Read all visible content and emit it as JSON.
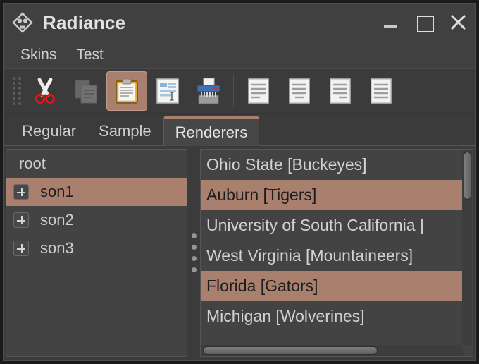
{
  "window": {
    "title": "Radiance",
    "app_icon": "diamond-logo-icon",
    "controls": {
      "minimize": "minimize-icon",
      "maximize": "maximize-icon",
      "close": "close-icon"
    }
  },
  "menubar": {
    "items": [
      {
        "label": "Skins"
      },
      {
        "label": "Test"
      }
    ]
  },
  "toolbar": {
    "grip": "drag-grip-icon",
    "buttons": [
      {
        "icon": "cut-scissors-icon",
        "label": "Cut",
        "state": "normal"
      },
      {
        "icon": "copy-icon",
        "label": "Copy",
        "state": "disabled"
      },
      {
        "icon": "paste-clipboard-icon",
        "label": "Paste",
        "state": "selected"
      },
      {
        "icon": "paste-special-icon",
        "label": "Paste Special",
        "state": "normal"
      },
      {
        "icon": "shredder-icon",
        "label": "Shred",
        "state": "normal"
      },
      {
        "icon": "align-left-icon",
        "label": "Align Left",
        "state": "normal"
      },
      {
        "icon": "align-center-icon",
        "label": "Align Center",
        "state": "normal"
      },
      {
        "icon": "align-right-icon",
        "label": "Align Right",
        "state": "normal"
      },
      {
        "icon": "align-justify-icon",
        "label": "Justify",
        "state": "normal"
      }
    ]
  },
  "tabs": {
    "items": [
      {
        "label": "Regular",
        "active": false
      },
      {
        "label": "Sample",
        "active": false
      },
      {
        "label": "Renderers",
        "active": true
      }
    ]
  },
  "tree": {
    "nodes": [
      {
        "label": "root",
        "expander": false,
        "selected": false
      },
      {
        "label": "son1",
        "expander": true,
        "selected": true
      },
      {
        "label": "son2",
        "expander": true,
        "selected": false
      },
      {
        "label": "son3",
        "expander": true,
        "selected": false
      }
    ]
  },
  "list": {
    "items": [
      {
        "label": "Ohio State [Buckeyes]",
        "selected": false
      },
      {
        "label": "Auburn [Tigers]",
        "selected": true
      },
      {
        "label": "University of South California |",
        "selected": false
      },
      {
        "label": "West Virginia [Mountaineers]",
        "selected": false
      },
      {
        "label": "Florida [Gators]",
        "selected": true
      },
      {
        "label": "Michigan [Wolverines]",
        "selected": false
      }
    ]
  },
  "colors": {
    "selection": "#a97f6e",
    "tab_accent": "#ad7f6d",
    "window_bg": "#3f3f3f",
    "pane_bg": "#434343",
    "text": "#cfcfcf"
  }
}
